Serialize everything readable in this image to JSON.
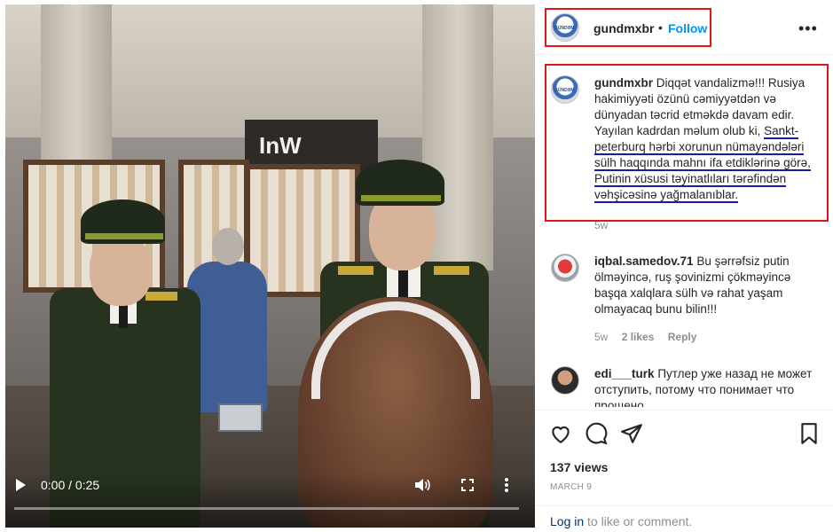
{
  "video": {
    "time_display": "0:00 / 0:25",
    "progress_fraction": 0,
    "store_sign": "InW"
  },
  "header": {
    "username": "gundmxbr",
    "separator": "•",
    "follow_label": "Follow",
    "more_label": "•••",
    "avatar_text": "GÜNDƏM"
  },
  "caption": {
    "username": "gundmxbr",
    "text_plain": "Diqqət vandalizmə!!! Rusiya hakimiyyəti özünü cəmiyyətdən və dünyadan təcrid etməkdə davam edir. Yayılan kadrdan məlum olub ki,",
    "text_underlined": "Sankt-peterburq hərbi xorunun nümayəndələri sülh haqqında mahnı ifa etdiklərinə görə, Putinin xüsusi təyinatlıları tərəfindən vəhşicəsinə yağmalanıblar.",
    "time": "5w"
  },
  "comments": [
    {
      "username": "iqbal.samedov.71",
      "text": "Bu şərrəfsiz putin ölməyincə, ruş şovinizmi çökməyincə başqa xalqlara sülh və rahat yaşam olmayacaq bunu bilin!!!",
      "time": "5w",
      "likes": "2 likes",
      "reply": "Reply"
    },
    {
      "username": "edi___turk",
      "text": "Путлер уже назад не может отступить, потому что понимает что прощено",
      "time": "",
      "likes": "",
      "reply": ""
    }
  ],
  "actions": {
    "icons": [
      "heart-icon",
      "comment-icon",
      "share-icon",
      "bookmark-icon"
    ],
    "views": "137 views",
    "date": "MARCH 9",
    "login_link": "Log in",
    "login_rest": " to like or comment."
  },
  "colors": {
    "accent": "#0095f6",
    "highlight_box": "#e0151b",
    "underline": "#1b1ba8",
    "link_dark": "#00376b"
  }
}
